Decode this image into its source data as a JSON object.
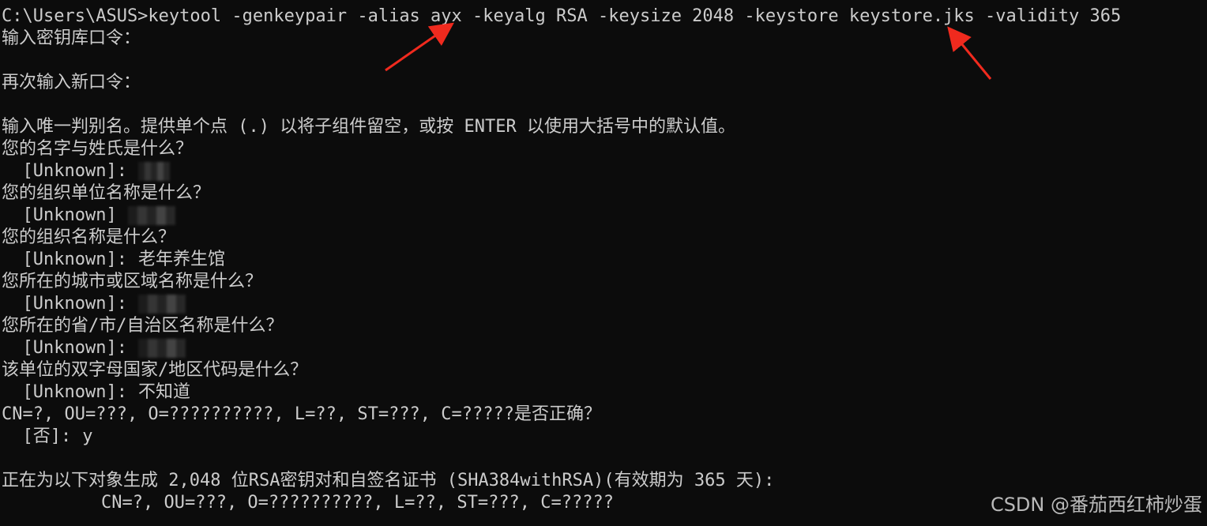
{
  "terminal": {
    "command_line": "C:\\Users\\ASUS>keytool -genkeypair -alias ayx -keyalg RSA -keysize 2048 -keystore keystore.jks -validity 365",
    "lines": {
      "keystore_password_prompt": "输入密钥库口令：",
      "reenter_password_prompt": "再次输入新口令：",
      "dn_instructions": "输入唯一判别名。提供单个点 (.) 以将子组件留空，或按 ENTER 以使用大括号中的默认值。",
      "q_name": "您的名字与姓氏是什么？",
      "a_name_prefix": "  [Unknown]:",
      "q_org_unit": "您的组织单位名称是什么？",
      "a_org_unit_prefix": "  [Unknown]",
      "q_org": "您的组织名称是什么？",
      "a_org_prefix": "  [Unknown]:",
      "a_org_value": "老年养生馆",
      "q_city": "您所在的城市或区域名称是什么？",
      "a_city_prefix": "  [Unknown]:",
      "q_state": "您所在的省/市/自治区名称是什么？",
      "a_state_prefix": "  [Unknown]:",
      "q_country": "该单位的双字母国家/地区代码是什么？",
      "a_country_prefix": "  [Unknown]:",
      "a_country_value": "不知道",
      "confirm_question": "CN=?, OU=???, O=??????????, L=??, ST=???, C=?????是否正确？",
      "confirm_prefix": "  [否]:",
      "confirm_value": "y",
      "generating": "正在为以下对象生成 2,048 位RSA密钥对和自签名证书 (SHA384withRSA)(有效期为 365 天):",
      "dn_result": "CN=?, OU=???, O=??????????, L=??, ST=???, C=?????"
    }
  },
  "annotations": {
    "arrow_color": "#f02a1e",
    "arrow_targets": [
      "ayx",
      "keystore.jks"
    ]
  },
  "watermark": "CSDN @番茄西红柿炒蛋"
}
